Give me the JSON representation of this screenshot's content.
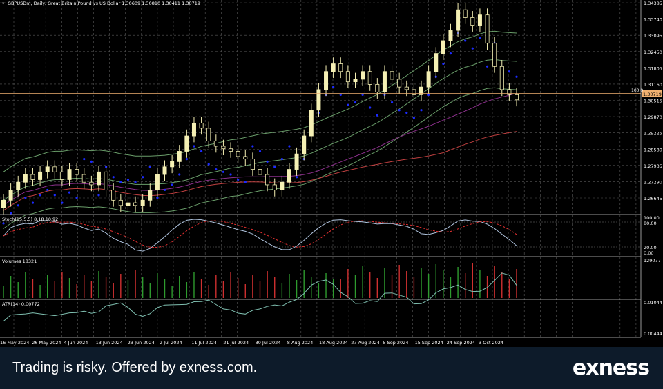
{
  "header": {
    "symbol_line": "GBPUSDm, Daily:  Great Britain Pound vs US Dollar  1.30609 1.30810 1.30411 1.30719"
  },
  "colors": {
    "background": "#000000",
    "grid": "#5a5a5a",
    "candle": "#f5f0b4",
    "sar": "#1c2bff",
    "bollinger": "#6a9e6a",
    "ma_slow": "#c04040",
    "ma_mid": "#8a2f8a",
    "price_line": "#f0b070",
    "stoch_main": "#b0c4de",
    "stoch_signal": "#e03030",
    "vol_up": "#2e9b2e",
    "vol_down": "#d03030",
    "atr": "#7fbfb0",
    "footer_bg": "#0d1b2a"
  },
  "price_axis": {
    "ticks": [
      "1.34385",
      "1.33740",
      "1.33095",
      "1.32450",
      "1.31805",
      "1.31160",
      "1.30515",
      "1.29870",
      "1.29225",
      "1.28580",
      "1.27935",
      "1.27290",
      "1.26645"
    ],
    "current_price": "1.30719",
    "level_label": "100.0"
  },
  "stoch": {
    "label": "Stoch(15,5,5) 8.18 10.92",
    "ticks": [
      "100.00",
      "80.00",
      "20.00",
      "0.00"
    ]
  },
  "volumes": {
    "label": "Volumes 18321",
    "max_tick": "129077"
  },
  "atr": {
    "label": "ATR(14) 0.00772",
    "ticks": [
      "0.01044",
      "0.00444"
    ]
  },
  "time_axis": {
    "labels": [
      "16 May 2024",
      "26 May 2024",
      "4 Jun 2024",
      "13 Jun 2024",
      "23 Jun 2024",
      "2 Jul 2024",
      "11 Jul 2024",
      "21 Jul 2024",
      "30 Jul 2024",
      "8 Aug 2024",
      "18 Aug 2024",
      "27 Aug 2024",
      "5 Sep 2024",
      "15 Sep 2024",
      "24 Sep 2024",
      "3 Oct 2024"
    ]
  },
  "chart_data": {
    "type": "candlestick",
    "close_path": [
      1.268,
      1.272,
      1.275,
      1.278,
      1.276,
      1.279,
      1.281,
      1.279,
      1.276,
      1.28,
      1.278,
      1.275,
      1.274,
      1.279,
      1.272,
      1.268,
      1.266,
      1.267,
      1.266,
      1.268,
      1.272,
      1.278,
      1.281,
      1.283,
      1.287,
      1.293,
      1.298,
      1.296,
      1.291,
      1.289,
      1.288,
      1.287,
      1.285,
      1.284,
      1.28,
      1.278,
      1.274,
      1.272,
      1.275,
      1.28,
      1.286,
      1.293,
      1.303,
      1.311,
      1.318,
      1.321,
      1.318,
      1.314,
      1.315,
      1.318,
      1.313,
      1.31,
      1.318,
      1.315,
      1.312,
      1.311,
      1.309,
      1.312,
      1.318,
      1.325,
      1.33,
      1.334,
      1.342,
      1.339,
      1.336,
      1.34,
      1.329,
      1.32,
      1.311,
      1.309,
      1.307
    ]
  },
  "footer": {
    "disclaimer": "Trading is risky. Offered by exness.com.",
    "logo": "exness"
  }
}
